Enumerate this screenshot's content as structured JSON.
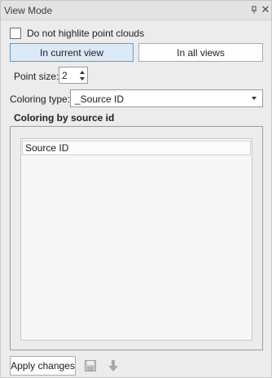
{
  "window": {
    "title": "View Mode",
    "pin_icon": "pin-icon",
    "close_icon": "close-icon",
    "close_glyph": "✕"
  },
  "options": {
    "do_not_highlight_label": "Do not highlite point clouds",
    "do_not_highlight_checked": false
  },
  "view_buttons": {
    "current_label": "In current view",
    "all_label": "In all views",
    "active": "current"
  },
  "point_size": {
    "label": "Point size:",
    "value": "2"
  },
  "coloring": {
    "label": "Coloring type:",
    "selected": "_Source ID"
  },
  "source_section": {
    "title": "Coloring by source id",
    "column_header": "Source ID",
    "rows": []
  },
  "footer": {
    "apply_label": "Apply changes",
    "save_icon": "save-icon",
    "down_icon": "arrow-down-icon"
  },
  "colors": {
    "active_button_bg": "#dbeaf6",
    "active_button_border": "#56a0d3",
    "panel_bg": "#ececec"
  }
}
